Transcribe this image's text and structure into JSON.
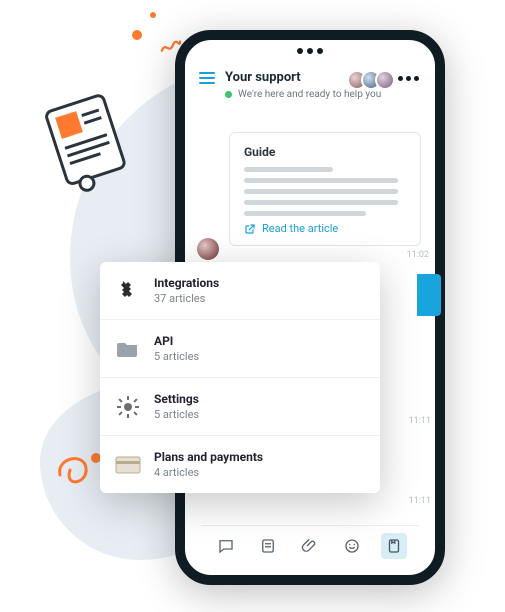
{
  "header": {
    "title": "Your support",
    "subtitle": "We're here and ready to help you"
  },
  "guide": {
    "heading": "Guide",
    "read_label": "Read the article"
  },
  "timestamps": {
    "t1": "11:02",
    "t2": "11:11",
    "t3": "11:11"
  },
  "categories": [
    {
      "icon": "plug",
      "title": "Integrations",
      "count": "37 articles"
    },
    {
      "icon": "folder",
      "title": "API",
      "count": "5 articles"
    },
    {
      "icon": "gear",
      "title": "Settings",
      "count": "5 articles"
    },
    {
      "icon": "card",
      "title": "Plans and payments",
      "count": "4 articles"
    }
  ]
}
